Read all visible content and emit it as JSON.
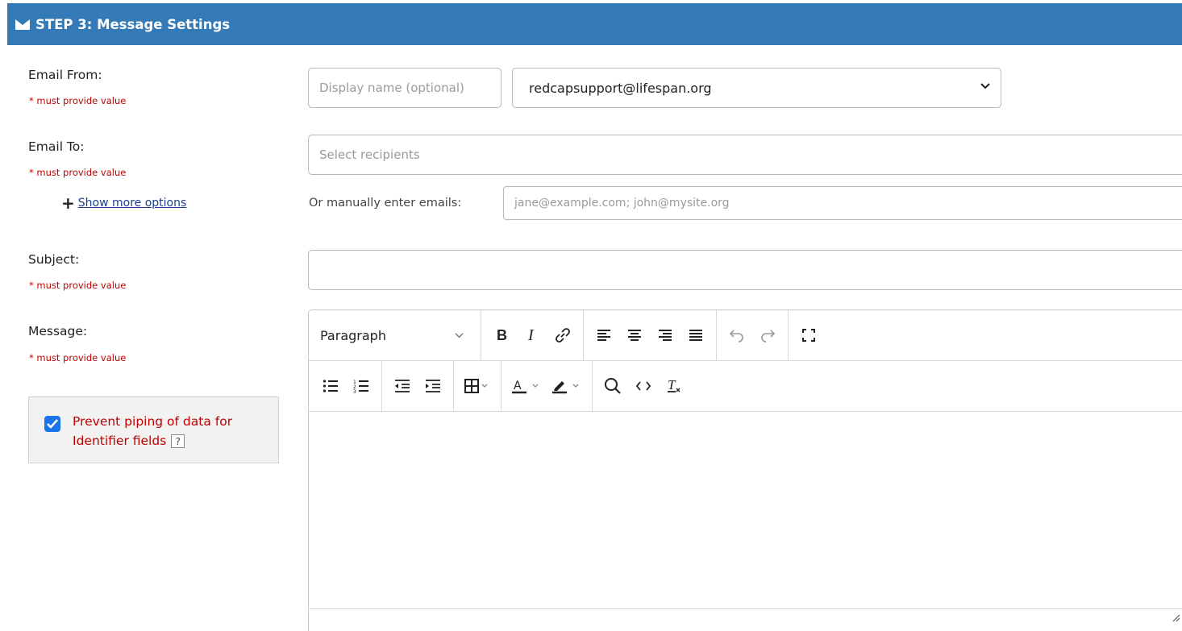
{
  "header": {
    "title": "STEP 3: Message Settings",
    "icon": "envelope-icon"
  },
  "required_note": "* must provide value",
  "email_from": {
    "label": "Email From:",
    "display_name_placeholder": "Display name (optional)",
    "selected_address": "redcapsupport@lifespan.org"
  },
  "email_to": {
    "label": "Email To:",
    "recipients_placeholder": "Select recipients",
    "show_more": "Show more options",
    "manual_label": "Or manually enter emails:",
    "manual_placeholder": "jane@example.com; john@mysite.org"
  },
  "subject": {
    "label": "Subject:",
    "value": ""
  },
  "message": {
    "label": "Message:",
    "block_format": "Paragraph",
    "toolbar_row1": [
      "bold-icon",
      "italic-icon",
      "link-icon",
      "align-left-icon",
      "align-center-icon",
      "align-right-icon",
      "align-justify-icon",
      "undo-icon",
      "redo-icon",
      "fullscreen-icon"
    ],
    "toolbar_row2": [
      "bullet-list-icon",
      "numbered-list-icon",
      "outdent-icon",
      "indent-icon",
      "table-icon",
      "text-color-icon",
      "highlight-icon",
      "search-icon",
      "code-icon",
      "clear-format-icon"
    ]
  },
  "prevent_piping": {
    "checked": true,
    "label_line1": "Prevent piping of data for",
    "label_line2": "Identifier fields",
    "help": "?"
  },
  "colors": {
    "header_bg": "#337ab7",
    "required": "#c00000",
    "checkbox": "#1a73e8"
  }
}
